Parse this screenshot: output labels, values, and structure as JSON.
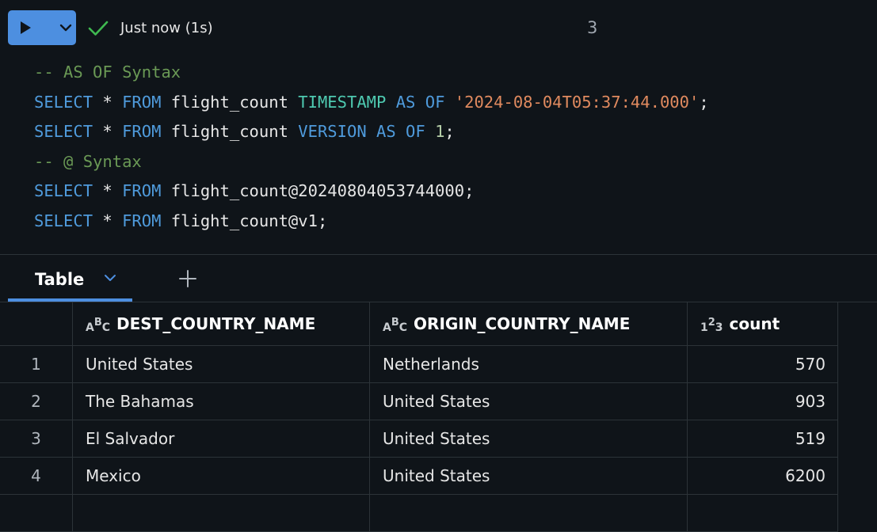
{
  "toolbar": {
    "status_text": "Just now (1s)",
    "cell_number": "3",
    "run_icon": "play-icon",
    "dropdown_icon": "chevron-down-icon",
    "status_icon": "check-icon",
    "accent_color": "#4d8fe0",
    "success_color": "#3fb950"
  },
  "code": {
    "lines": [
      [
        {
          "t": "-- AS OF Syntax",
          "c": "cmt"
        }
      ],
      [
        {
          "t": "SELECT",
          "c": "kw"
        },
        {
          "t": " * ",
          "c": "punc"
        },
        {
          "t": "FROM",
          "c": "kw"
        },
        {
          "t": " flight_count ",
          "c": "punc"
        },
        {
          "t": "TIMESTAMP",
          "c": "ts"
        },
        {
          "t": " ",
          "c": "punc"
        },
        {
          "t": "AS",
          "c": "kw"
        },
        {
          "t": " ",
          "c": "punc"
        },
        {
          "t": "OF",
          "c": "kw"
        },
        {
          "t": " ",
          "c": "punc"
        },
        {
          "t": "'2024-08-04T05:37:44.000'",
          "c": "str"
        },
        {
          "t": ";",
          "c": "punc"
        }
      ],
      [
        {
          "t": "SELECT",
          "c": "kw"
        },
        {
          "t": " * ",
          "c": "punc"
        },
        {
          "t": "FROM",
          "c": "kw"
        },
        {
          "t": " flight_count ",
          "c": "punc"
        },
        {
          "t": "VERSION",
          "c": "kw"
        },
        {
          "t": " ",
          "c": "punc"
        },
        {
          "t": "AS",
          "c": "kw"
        },
        {
          "t": " ",
          "c": "punc"
        },
        {
          "t": "OF",
          "c": "kw"
        },
        {
          "t": " ",
          "c": "punc"
        },
        {
          "t": "1",
          "c": "num"
        },
        {
          "t": ";",
          "c": "punc"
        }
      ],
      [
        {
          "t": "-- @ Syntax",
          "c": "cmt"
        }
      ],
      [
        {
          "t": "SELECT",
          "c": "kw"
        },
        {
          "t": " * ",
          "c": "punc"
        },
        {
          "t": "FROM",
          "c": "kw"
        },
        {
          "t": " flight_count@20240804053744000;",
          "c": "punc"
        }
      ],
      [
        {
          "t": "SELECT",
          "c": "kw"
        },
        {
          "t": " * ",
          "c": "punc"
        },
        {
          "t": "FROM",
          "c": "kw"
        },
        {
          "t": " flight_count@v1;",
          "c": "punc"
        }
      ]
    ]
  },
  "tabs": {
    "active_label": "Table",
    "dropdown_icon": "chevron-down-icon",
    "add_icon": "plus-icon"
  },
  "table": {
    "columns": [
      {
        "label": "DEST_COUNTRY_NAME",
        "type_icon": "string-type-icon",
        "type_glyph": [
          "A",
          "B",
          "C"
        ]
      },
      {
        "label": "ORIGIN_COUNTRY_NAME",
        "type_icon": "string-type-icon",
        "type_glyph": [
          "A",
          "B",
          "C"
        ]
      },
      {
        "label": "count",
        "type_icon": "number-type-icon",
        "type_glyph": [
          "1",
          "2",
          "3"
        ]
      }
    ],
    "rows": [
      {
        "num": "1",
        "dest": "United States",
        "orig": "Netherlands",
        "count": "570"
      },
      {
        "num": "2",
        "dest": "The Bahamas",
        "orig": "United States",
        "count": "903"
      },
      {
        "num": "3",
        "dest": "El Salvador",
        "orig": "United States",
        "count": "519"
      },
      {
        "num": "4",
        "dest": "Mexico",
        "orig": "United States",
        "count": "6200"
      }
    ]
  }
}
